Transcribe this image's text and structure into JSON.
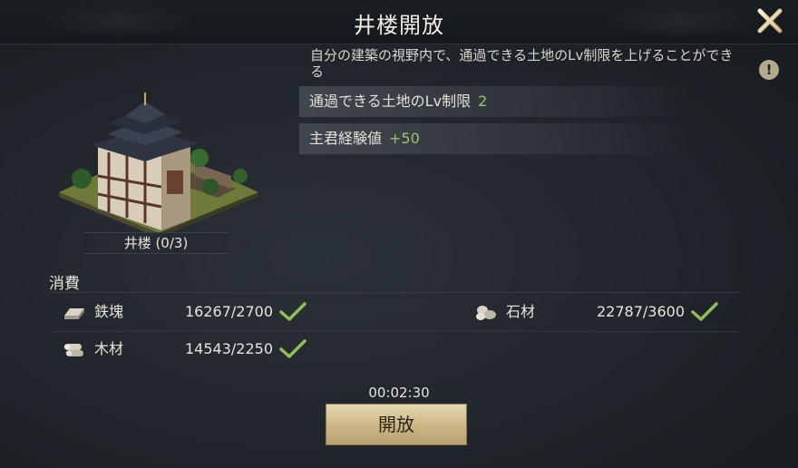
{
  "dialog": {
    "title": "井楼開放",
    "close_icon": "close-x-icon",
    "description": "自分の建築の視野内で、通過できる土地のLv制限を上げることができる",
    "info_icon_glyph": "!"
  },
  "stats": [
    {
      "label": "通過できる土地のLv制限",
      "value": "2"
    },
    {
      "label": "主君経験値",
      "value": "+50"
    }
  ],
  "building": {
    "name": "井楼 (0/3)",
    "image": "watchtower-building-illustration"
  },
  "cost": {
    "title": "消費",
    "resources": [
      {
        "name": "鉄塊",
        "amount": "16267/2700",
        "icon": "iron-ingot-icon",
        "sufficient": true
      },
      {
        "name": "石材",
        "amount": "22787/3600",
        "icon": "stone-icon",
        "sufficient": true
      },
      {
        "name": "木材",
        "amount": "14543/2250",
        "icon": "wood-logs-icon",
        "sufficient": true
      }
    ]
  },
  "timer": "00:02:30",
  "action": {
    "label": "開放"
  },
  "colors": {
    "accent_green": "#9ec46a",
    "button_gold": "#cdb887"
  }
}
